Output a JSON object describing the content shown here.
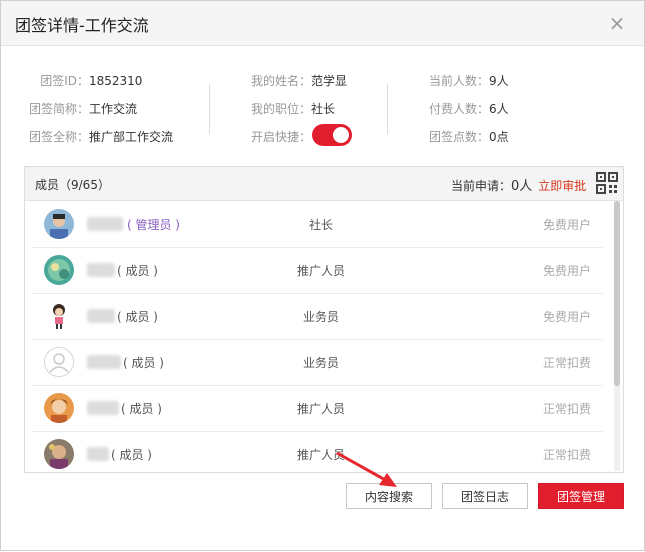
{
  "dialog": {
    "title": "团签详情-工作交流",
    "close_glyph": "×"
  },
  "info": {
    "col1": [
      {
        "label": "团签ID：",
        "value": "1852310"
      },
      {
        "label": "团签简称：",
        "value": "工作交流"
      },
      {
        "label": "团签全称：",
        "value": "推广部工作交流"
      }
    ],
    "col2": [
      {
        "label": "我的姓名：",
        "value": "范学显"
      },
      {
        "label": "我的职位：",
        "value": "社长"
      },
      {
        "label": "开启快捷：",
        "value": ""
      }
    ],
    "col3": [
      {
        "label": "当前人数：",
        "value": "9人"
      },
      {
        "label": "付费人数：",
        "value": "6人"
      },
      {
        "label": "团签点数：",
        "value": "0点"
      }
    ],
    "quick_toggle_on": true,
    "toggle_color": "#e01e2e"
  },
  "members": {
    "title": "成员（9/65）",
    "pending_label": "当前申请：",
    "pending_count": "0人",
    "approve_link": "立即审批",
    "qr_icon": "qr-code-icon",
    "rows": [
      {
        "role": "( 管理员 )",
        "position": "社长",
        "status": "免费用户",
        "avatar": "photo"
      },
      {
        "role": "( 成员 )",
        "position": "推广人员",
        "status": "免费用户",
        "avatar": "photo"
      },
      {
        "role": "( 成员 )",
        "position": "业务员",
        "status": "免费用户",
        "avatar": "cartoon"
      },
      {
        "role": "( 成员 )",
        "position": "业务员",
        "status": "正常扣费",
        "avatar": "default-user-icon"
      },
      {
        "role": "( 成员 )",
        "position": "推广人员",
        "status": "正常扣费",
        "avatar": "photo"
      },
      {
        "role": "( 成员 )",
        "position": "推广人员",
        "status": "正常扣费",
        "avatar": "photo"
      }
    ]
  },
  "footer": {
    "search_button": "内容搜索",
    "log_button": "团签日志",
    "manage_button": "团签管理",
    "accent": "#e01e2e"
  }
}
